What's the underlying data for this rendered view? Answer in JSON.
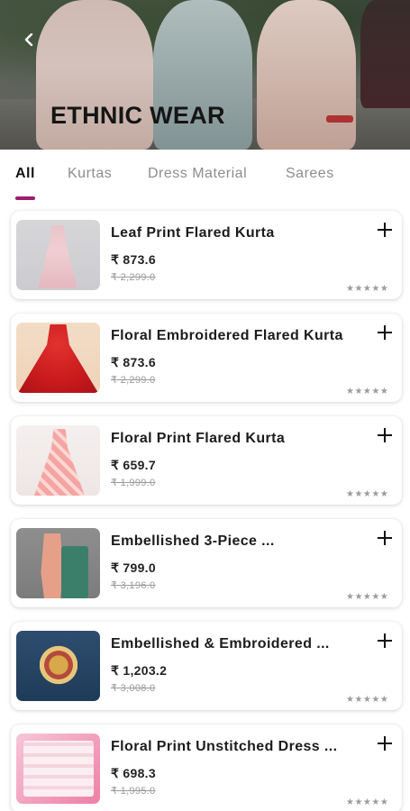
{
  "hero": {
    "title": "ETHNIC WEAR"
  },
  "icons": {
    "back": "back-arrow-icon",
    "add": "plus-icon",
    "rating": "star-icon"
  },
  "colors": {
    "accent": "#9b1f6b",
    "active_tab_text": "#151515",
    "inactive_tab_text": "#8d8d8d",
    "mrp_text": "#9a9a9a"
  },
  "tabs": [
    {
      "label": "All",
      "active": true
    },
    {
      "label": "Kurtas",
      "active": false
    },
    {
      "label": "Dress Material",
      "active": false
    },
    {
      "label": "Sarees",
      "active": false
    }
  ],
  "products": [
    {
      "name": "Leaf Print Flared Kurta",
      "price": "₹ 873.6",
      "mrp": "₹ 2,299.0",
      "rating": "★★★★★"
    },
    {
      "name": "Floral Embroidered Flared Kurta",
      "price": "₹ 873.6",
      "mrp": "₹ 2,299.0",
      "rating": "★★★★★"
    },
    {
      "name": "Floral Print Flared Kurta",
      "price": "₹ 659.7",
      "mrp": "₹ 1,999.0",
      "rating": "★★★★★"
    },
    {
      "name": "Embellished 3-Piece ...",
      "price": "₹ 799.0",
      "mrp": "₹ 3,196.0",
      "rating": "★★★★★"
    },
    {
      "name": "Embellished & Embroidered ...",
      "price": "₹ 1,203.2",
      "mrp": "₹ 3,008.0",
      "rating": "★★★★★"
    },
    {
      "name": "Floral Print Unstitched Dress ...",
      "price": "₹ 698.3",
      "mrp": "₹ 1,995.0",
      "rating": "★★★★★"
    }
  ]
}
